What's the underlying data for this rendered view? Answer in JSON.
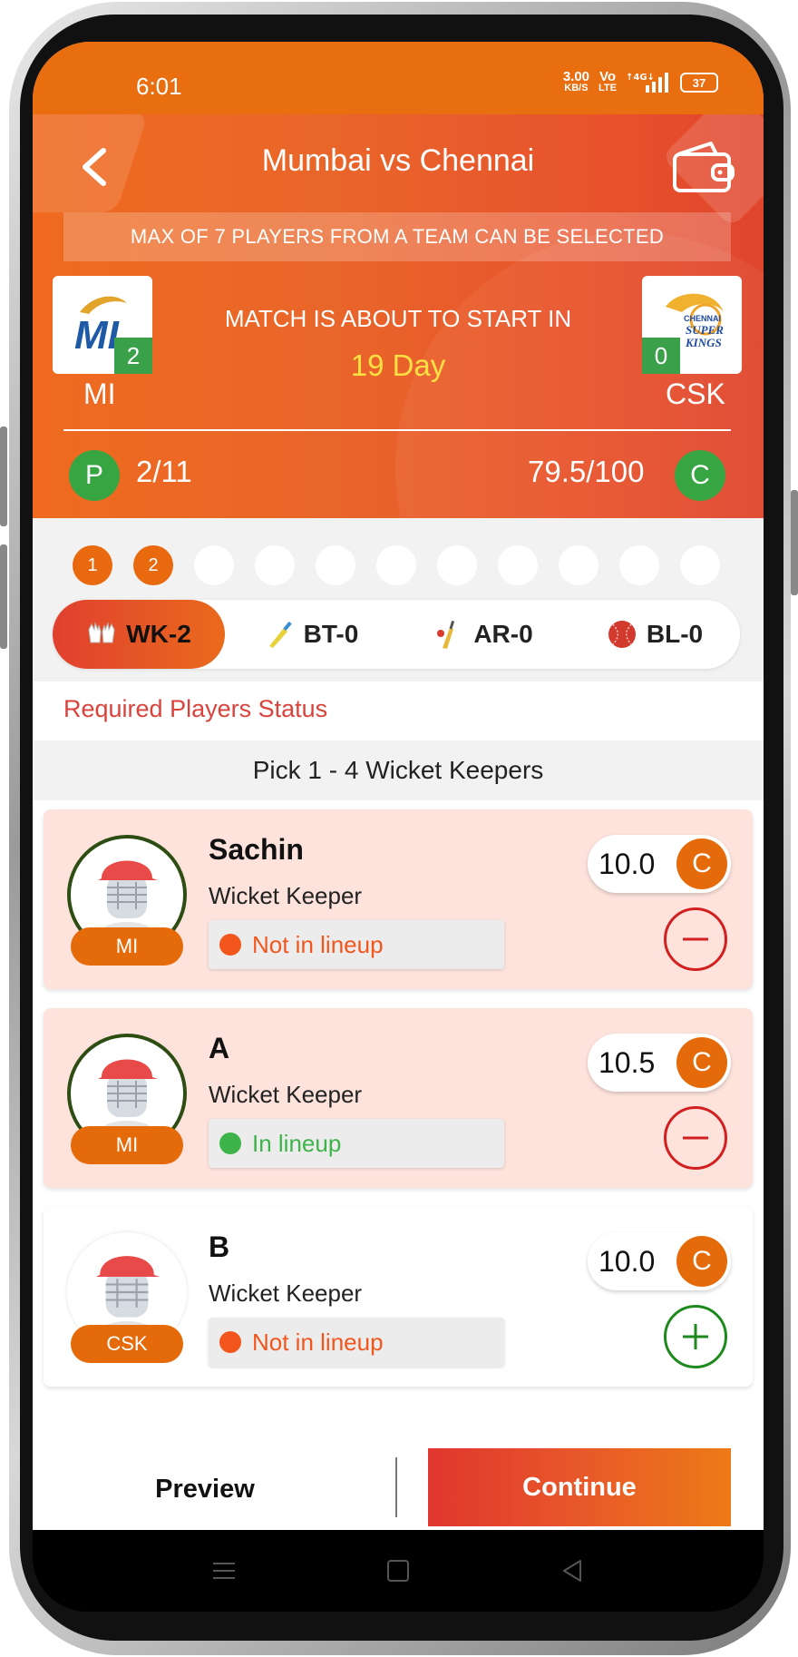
{
  "status_bar": {
    "time": "6:01",
    "net_speed_top": "3.00",
    "net_speed_bottom": "KB/S",
    "volte_top": "Vo",
    "volte_bottom": "LTE",
    "network": "4G",
    "battery": "37"
  },
  "header": {
    "title": "Mumbai vs Chennai",
    "max_notice": "MAX OF 7 PLAYERS FROM A TEAM CAN BE SELECTED"
  },
  "match": {
    "start_label": "MATCH IS ABOUT TO START IN",
    "countdown": "19 Day",
    "team_left": {
      "name": "MI",
      "count": "2",
      "logo_text": "MI"
    },
    "team_right": {
      "name": "CSK",
      "count": "0",
      "logo_text_top": "CHENNAI",
      "logo_text_mid": "SUPER",
      "logo_text_bottom": "KINGS"
    }
  },
  "stats": {
    "players_icon": "P",
    "players": "2/11",
    "credits": "79.5/100",
    "credits_icon": "C"
  },
  "progress_dots": [
    "1",
    "2",
    "",
    "",
    "",
    "",
    "",
    "",
    "",
    "",
    ""
  ],
  "tabs": [
    {
      "label": "WK-2",
      "icon": "gloves-icon"
    },
    {
      "label": "BT-0",
      "icon": "bat-icon"
    },
    {
      "label": "AR-0",
      "icon": "bat-ball-icon"
    },
    {
      "label": "BL-0",
      "icon": "ball-icon"
    }
  ],
  "required_status": "Required Players Status",
  "pick_hint": "Pick 1 - 4 Wicket Keepers",
  "players": [
    {
      "name": "Sachin",
      "role": "Wicket Keeper",
      "team": "MI",
      "lineup": "Not in lineup",
      "credit": "10.0",
      "credit_icon": "C",
      "selected": true
    },
    {
      "name": "A",
      "role": "Wicket Keeper",
      "team": "MI",
      "lineup": "In lineup",
      "credit": "10.5",
      "credit_icon": "C",
      "selected": true
    },
    {
      "name": "B",
      "role": "Wicket Keeper",
      "team": "CSK",
      "lineup": "Not in lineup",
      "credit": "10.0",
      "credit_icon": "C",
      "selected": false
    }
  ],
  "footer": {
    "preview": "Preview",
    "continue": "Continue"
  },
  "colors": {
    "orange": "#e56a09",
    "green": "#36a542",
    "red": "#d9433b",
    "selected_bg": "#fde3dc"
  }
}
